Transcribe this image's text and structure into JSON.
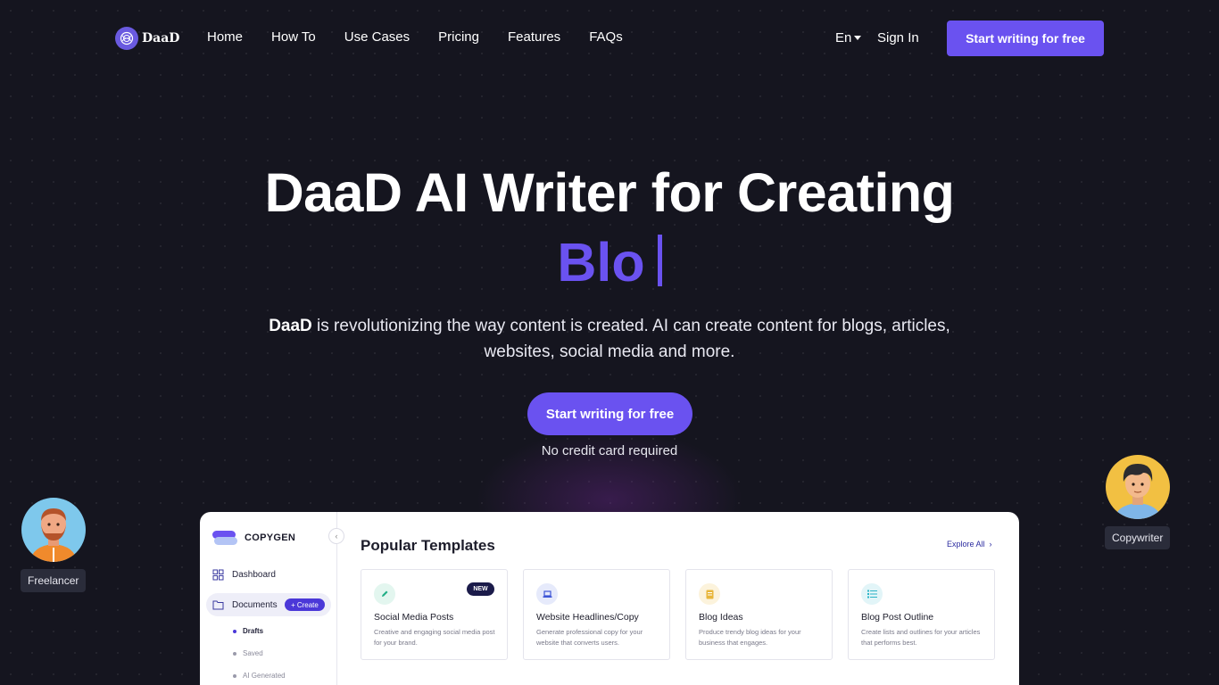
{
  "nav": {
    "brand": "DaaD",
    "links": [
      "Home",
      "How To",
      "Use Cases",
      "Pricing",
      "Features",
      "FAQs"
    ],
    "language": "En",
    "signin": "Sign In",
    "cta": "Start writing for free"
  },
  "hero": {
    "title": "DaaD AI Writer for Creating",
    "typed": "Blo",
    "sub_brand": "DaaD",
    "sub_text_1": " is revolutionizing the way content is created. AI can create content for blogs, articles,",
    "sub_text_2": "websites, social media and more.",
    "cta": "Start writing for free",
    "note": "No credit card required"
  },
  "avatars": {
    "left_label": "Freelancer",
    "right_label": "Copywriter"
  },
  "app": {
    "brand": "COPYGEN",
    "sidebar": {
      "dashboard": "Dashboard",
      "documents": "Documents",
      "create": "Create",
      "sub_items": [
        "Drafts",
        "Saved",
        "AI Generated"
      ]
    },
    "main_title": "Popular Templates",
    "explore": "Explore All",
    "cards": [
      {
        "title": "Social Media Posts",
        "desc": "Creative and engaging social media post for your brand.",
        "badge": "NEW",
        "icon": "pencil-icon",
        "color": "#1fae84"
      },
      {
        "title": "Website Headlines/Copy",
        "desc": "Generate professional copy for your website that converts users.",
        "icon": "laptop-icon",
        "color": "#3d55d6"
      },
      {
        "title": "Blog Ideas",
        "desc": "Produce trendy blog ideas for your business that engages.",
        "icon": "document-icon",
        "color": "#e8b63a"
      },
      {
        "title": "Blog Post Outline",
        "desc": "Create lists and outlines for your articles that performs best.",
        "icon": "list-icon",
        "color": "#2bb3c6"
      }
    ]
  },
  "colors": {
    "background": "#15151f",
    "accent": "#6a52f0",
    "dark_accent": "#4b38d8"
  }
}
